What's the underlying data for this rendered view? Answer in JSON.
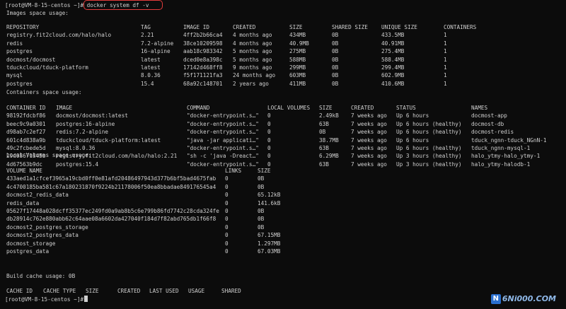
{
  "prompt": "[root@VM-8-15-centos ~]#",
  "command": " docker system df -v",
  "images_title": "Images space usage:",
  "images_headers": [
    "REPOSITORY",
    "TAG",
    "IMAGE ID",
    "CREATED",
    "SIZE",
    "SHARED SIZE",
    "UNIQUE SIZE",
    "CONTAINERS"
  ],
  "images": [
    [
      "registry.fit2cloud.com/halo/halo",
      "2.21",
      "4ff2b2b66ca4",
      "4 months ago",
      "434MB",
      "0B",
      "433.5MB",
      "1"
    ],
    [
      "redis",
      "7.2-alpine",
      "38ce10209598",
      "4 months ago",
      "40.9MB",
      "0B",
      "40.91MB",
      "1"
    ],
    [
      "postgres",
      "16-alpine",
      "aab18c983342",
      "5 months ago",
      "275MB",
      "0B",
      "275.4MB",
      "1"
    ],
    [
      "docmost/docmost",
      "latest",
      "dced0e8a398c",
      "5 months ago",
      "588MB",
      "0B",
      "588.4MB",
      "1"
    ],
    [
      "tduckcloud/tduck-platform",
      "latest",
      "17142d468ff8",
      "9 months ago",
      "299MB",
      "0B",
      "299.4MB",
      "1"
    ],
    [
      "mysql",
      "8.0.36",
      "f5f171121fa3",
      "24 months ago",
      "603MB",
      "0B",
      "602.9MB",
      "1"
    ],
    [
      "postgres",
      "15.4",
      "68a92c148701",
      "2 years ago",
      "411MB",
      "0B",
      "410.6MB",
      "1"
    ]
  ],
  "containers_title": "Containers space usage:",
  "containers_headers": [
    "CONTAINER ID",
    "IMAGE",
    "COMMAND",
    "LOCAL VOLUMES",
    "SIZE",
    "CREATED",
    "STATUS",
    "NAMES"
  ],
  "containers": [
    [
      "98192fdcbf86",
      "docmost/docmost:latest",
      "\"docker-entrypoint.s…\"",
      "0",
      "2.49kB",
      "7 weeks ago",
      "Up 6 hours",
      "docmost-app"
    ],
    [
      "beec9c9a0301",
      "postgres:16-alpine",
      "\"docker-entrypoint.s…\"",
      "0",
      "63B",
      "7 weeks ago",
      "Up 6 hours (healthy)",
      "docmost-db"
    ],
    [
      "d98ab7c2ef27",
      "redis:7.2-alpine",
      "\"docker-entrypoint.s…\"",
      "0",
      "0B",
      "7 weeks ago",
      "Up 6 hours (healthy)",
      "docmost-redis"
    ],
    [
      "601c4d838a9b",
      "tduckcloud/tduck-platform:latest",
      "\"java -jar applicati…\"",
      "0",
      "38.7MB",
      "7 weeks ago",
      "Up 6 hours",
      "tduck_ngnn-tduck_NGnN-1"
    ],
    [
      "49c2fcbede5d",
      "mysql:8.0.36",
      "\"docker-entrypoint.s…\"",
      "0",
      "63B",
      "7 weeks ago",
      "Up 6 hours (healthy)",
      "tduck_ngnn-mysql-1"
    ],
    [
      "29d08671845b",
      "registry.fit2cloud.com/halo/halo:2.21",
      "\"sh -c 'java -Dreact…\"",
      "0",
      "6.29MB",
      "7 weeks ago",
      "Up 3 hours (healthy)",
      "halo_ytmy-halo_ytmy-1"
    ],
    [
      "4d67563b9dc",
      "postgres:15.4",
      "\"docker-entrypoint.s…\"",
      "0",
      "63B",
      "7 weeks ago",
      "Up 3 hours (healthy)",
      "halo_ytmy-halodb-1"
    ]
  ],
  "volumes_title": "Local Volumes space usage:",
  "volumes_headers": [
    "VOLUME NAME",
    "LINKS",
    "SIZE"
  ],
  "volumes": [
    [
      "433aed1a1cfcef3965a19cbd0ff0e81afd20486497943d377b6bf5bad4675fab",
      "0",
      "0B"
    ],
    [
      "4c4700185ba581c67a180231870f9224b21178006f50ea8bbadae849176545a4",
      "0",
      "0B"
    ],
    [
      "docmost2_redis_data",
      "0",
      "65.12kB"
    ],
    [
      "redis_data",
      "0",
      "141.6kB"
    ],
    [
      "05627f17448a028dcff35377ec249fd0a9ab8b5c6e799b86fd7742c28cda324fe",
      "0",
      "0B"
    ],
    [
      "db28914c762e880abb62c64aae08a6602da427040f184d7f82abd765db1f66f8",
      "0",
      "0B"
    ],
    [
      "docmost2_postgres_storage",
      "0",
      "0B"
    ],
    [
      "docmost2_postgres_data",
      "0",
      "67.15MB"
    ],
    [
      "docmost_storage",
      "0",
      "1.297MB"
    ],
    [
      "postgres_data",
      "0",
      "67.03MB"
    ]
  ],
  "build_cache_line": "Build cache usage: 0B",
  "cache_headers": [
    "CACHE ID",
    "CACHE TYPE",
    "SIZE",
    "CREATED",
    "LAST USED",
    "USAGE",
    "SHARED"
  ],
  "final_prompt": "[root@VM-8-15-centos ~]#",
  "watermark": {
    "mark": "N",
    "text": "6Ni000.COM"
  },
  "colors": {
    "background": "#0c0c0c",
    "text": "#cfcfcf",
    "highlight": "#e23b3b"
  }
}
